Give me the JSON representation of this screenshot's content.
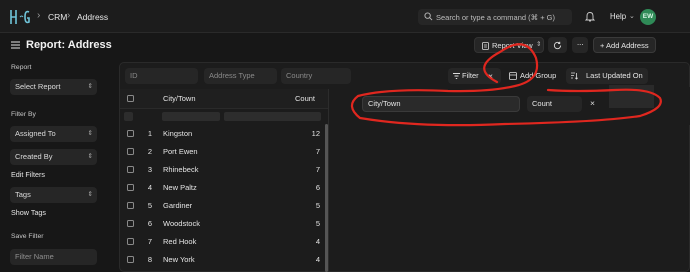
{
  "navbar": {
    "breadcrumbs": [
      "CRM",
      "Address"
    ],
    "search_placeholder": "Search or type a command (⌘ + G)",
    "help_label": "Help",
    "avatar_initials": "EW"
  },
  "header": {
    "title": "Report: Address",
    "view_button": "Report View",
    "add_button": "+ Add Address"
  },
  "sidebar": {
    "report_label": "Report",
    "report_select": "Select Report",
    "filter_by_label": "Filter By",
    "assigned_to": "Assigned To",
    "created_by": "Created By",
    "edit_filters": "Edit Filters",
    "tags_select": "Tags",
    "show_tags": "Show Tags",
    "save_filter_label": "Save Filter",
    "filter_name_placeholder": "Filter Name"
  },
  "toolbar": {
    "filter_inputs": [
      "ID",
      "Address Type",
      "Country"
    ],
    "filter_button": "Filter",
    "add_group_button": "Add Group",
    "sort_button": "Last Updated On"
  },
  "table": {
    "columns": [
      "City/Town",
      "Count"
    ],
    "rows": [
      {
        "num": "1",
        "city": "Kingston",
        "count": "12"
      },
      {
        "num": "2",
        "city": "Port Ewen",
        "count": "7"
      },
      {
        "num": "3",
        "city": "Rhinebeck",
        "count": "7"
      },
      {
        "num": "4",
        "city": "New Paltz",
        "count": "6"
      },
      {
        "num": "5",
        "city": "Gardiner",
        "count": "5"
      },
      {
        "num": "6",
        "city": "Woodstock",
        "count": "5"
      },
      {
        "num": "7",
        "city": "Red Hook",
        "count": "4"
      },
      {
        "num": "8",
        "city": "New York",
        "count": "4"
      }
    ]
  },
  "group_by": {
    "field": "City/Town",
    "aggregate": "Count",
    "close_symbol": "×"
  },
  "colors": {
    "background": "#171717",
    "panel": "#1c1c1c",
    "control": "#262626",
    "annotation": "#e0271f",
    "avatar": "#2f8a57"
  }
}
